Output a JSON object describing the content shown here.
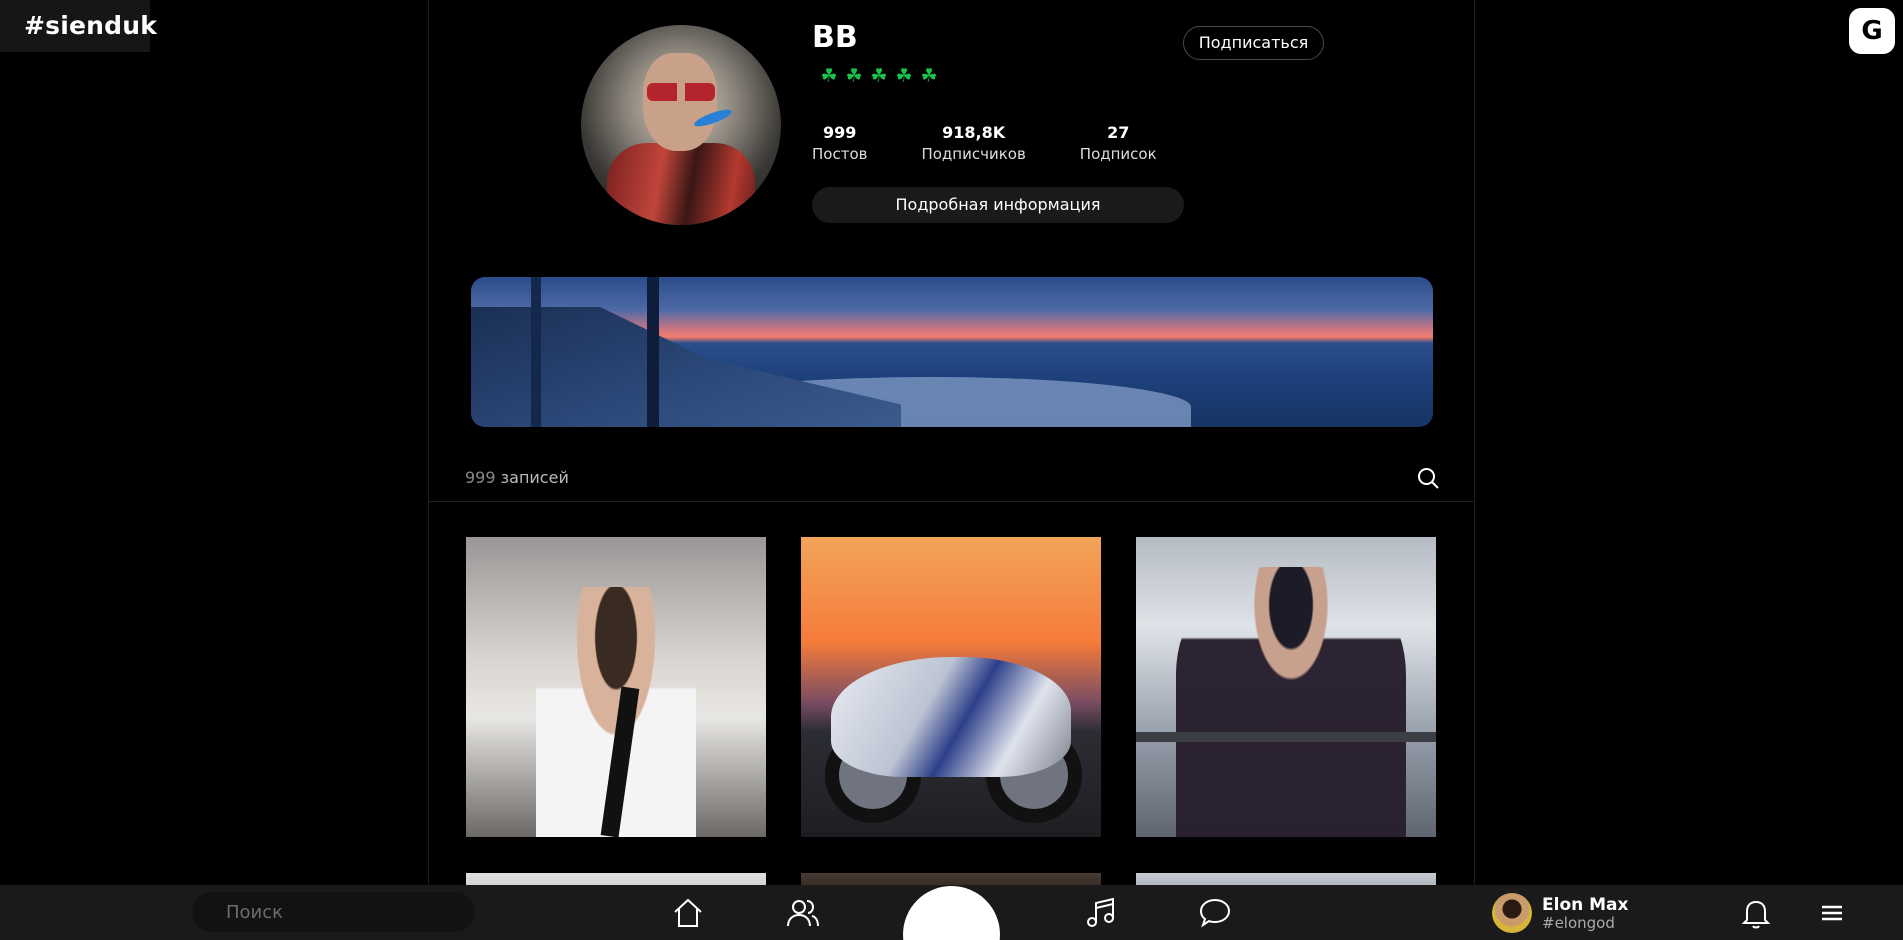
{
  "site_tag": "#sienduk",
  "corner_badge": "G",
  "profile": {
    "name": "BB",
    "clovers": [
      "☘",
      "☘",
      "☘",
      "☘",
      "☘"
    ],
    "follow_label": "Подписаться",
    "stats": [
      {
        "value": "999",
        "label": "Постов"
      },
      {
        "value": "918,8K",
        "label": "Подписчиков"
      },
      {
        "value": "27",
        "label": "Подписок"
      }
    ],
    "info_label": "Подробная информация"
  },
  "posts": {
    "count": "999",
    "count_label": " записей"
  },
  "bottom_bar": {
    "search_placeholder": "Поиск",
    "user_name": "Elon Max",
    "user_handle": "#elongod"
  },
  "colors": {
    "background": "#000000",
    "clover": "#19c24a",
    "bar": "#1a1a1a"
  },
  "icons": [
    "search-icon",
    "home-icon",
    "friends-icon",
    "music-icon",
    "chat-icon",
    "bell-icon",
    "menu-icon"
  ]
}
